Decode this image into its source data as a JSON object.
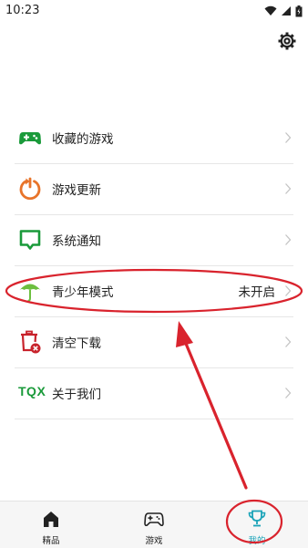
{
  "status_bar": {
    "time": "10:23"
  },
  "menu": [
    {
      "label": "收藏的游戏",
      "value": "",
      "icon": "gamepad-icon"
    },
    {
      "label": "游戏更新",
      "value": "",
      "icon": "refresh-icon"
    },
    {
      "label": "系统通知",
      "value": "",
      "icon": "message-icon"
    },
    {
      "label": "青少年模式",
      "value": "未开启",
      "icon": "umbrella-icon"
    },
    {
      "label": "清空下载",
      "value": "",
      "icon": "trash-icon"
    },
    {
      "label": "关于我们",
      "value": "",
      "icon": "tqx-logo",
      "logo_text": "TQX"
    }
  ],
  "bottom_nav": [
    {
      "label": "精品",
      "icon": "home-icon",
      "active": false
    },
    {
      "label": "游戏",
      "icon": "gamepad-icon",
      "active": false
    },
    {
      "label": "我的",
      "icon": "trophy-icon",
      "active": true
    }
  ],
  "colors": {
    "accent": "#1aa3b8",
    "annotation": "#d9232d",
    "icon_green": "#1a9a3a",
    "icon_orange": "#e8742a",
    "icon_red": "#c8232c"
  }
}
